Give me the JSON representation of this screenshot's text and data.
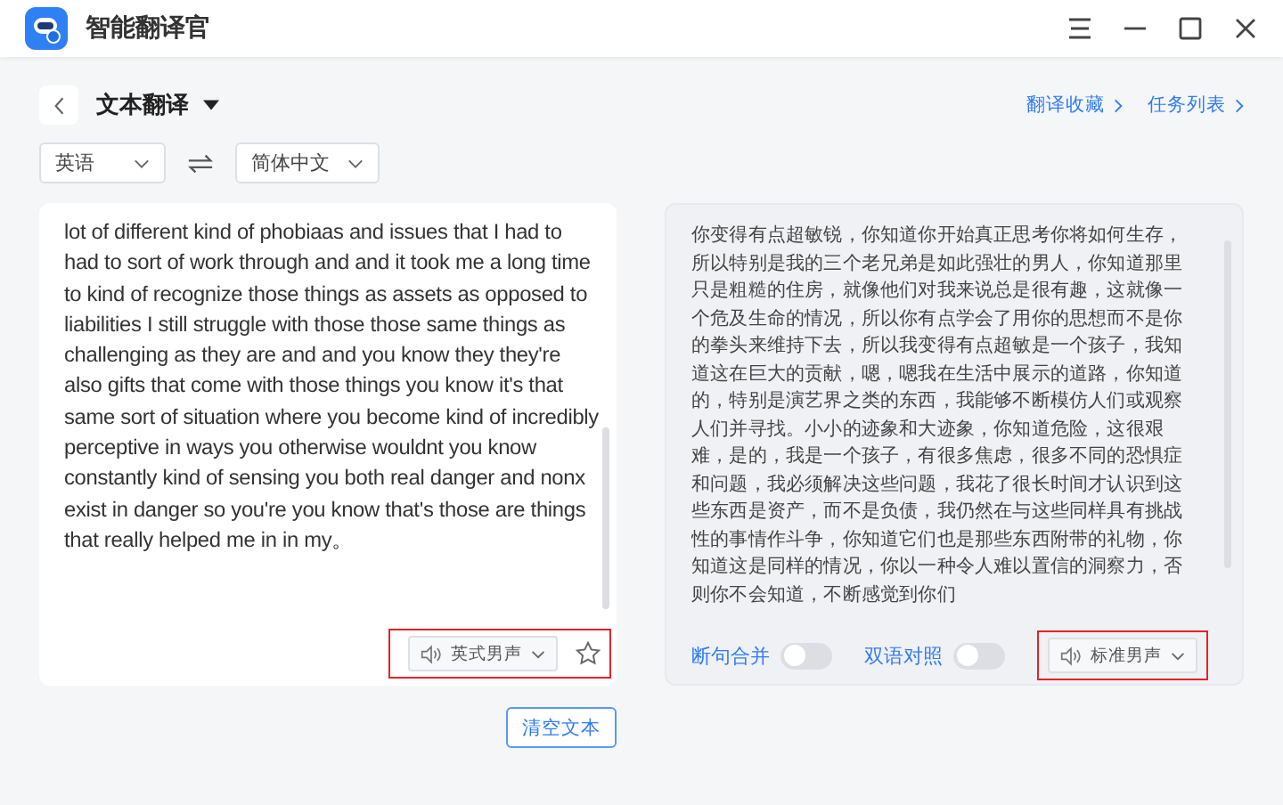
{
  "window": {
    "title": "智能翻译官"
  },
  "header": {
    "title": "文本翻译",
    "links": [
      "翻译收藏",
      "任务列表"
    ]
  },
  "languages": {
    "source": "英语",
    "target": "简体中文"
  },
  "source_panel": {
    "text": "lot of different kind of phobiaas and issues that I had to had to sort of work through and and it took me a long time to kind of recognize those things as assets as opposed to liabilities I still struggle with those those same things as challenging as they are and and you know they they're also gifts that come with those things you know it's that same sort of situation where you become kind of incredibly perceptive in ways you otherwise wouldnt you know constantly kind of sensing you both real danger and nonx exist in danger so you're you know that's those are things that really helped me in in my。",
    "voice": "英式男声",
    "favorite": false
  },
  "target_panel": {
    "text": "你变得有点超敏锐，你知道你开始真正思考你将如何生存，所以特别是我的三个老兄弟是如此强壮的男人，你知道那里只是粗糙的住房，就像他们对我来说总是很有趣，这就像一个危及生命的情况，所以你有点学会了用你的思想而不是你的拳头来维持下去，所以我变得有点超敏是一个孩子，我知道这在巨大的贡献，嗯，嗯我在生活中展示的道路，你知道的，特别是演艺界之类的东西，我能够不断模仿人们或观察人们并寻找。小小的迹象和大迹象，你知道危险，这很艰难，是的，我是一个孩子，有很多焦虑，很多不同的恐惧症和问题，我必须解决这些问题，我花了很长时间才认识到这些东西是资产，而不是负债，我仍然在与这些同样具有挑战性的事情作斗争，你知道它们也是那些东西附带的礼物，你知道这是同样的情况，你以一种令人难以置信的洞察力，否则你不会知道，不断感觉到你们",
    "toggles": [
      {
        "label": "断句合并",
        "on": false
      },
      {
        "label": "双语对照",
        "on": false
      }
    ],
    "voice": "标准男声"
  },
  "clear_button": "清空文本"
}
